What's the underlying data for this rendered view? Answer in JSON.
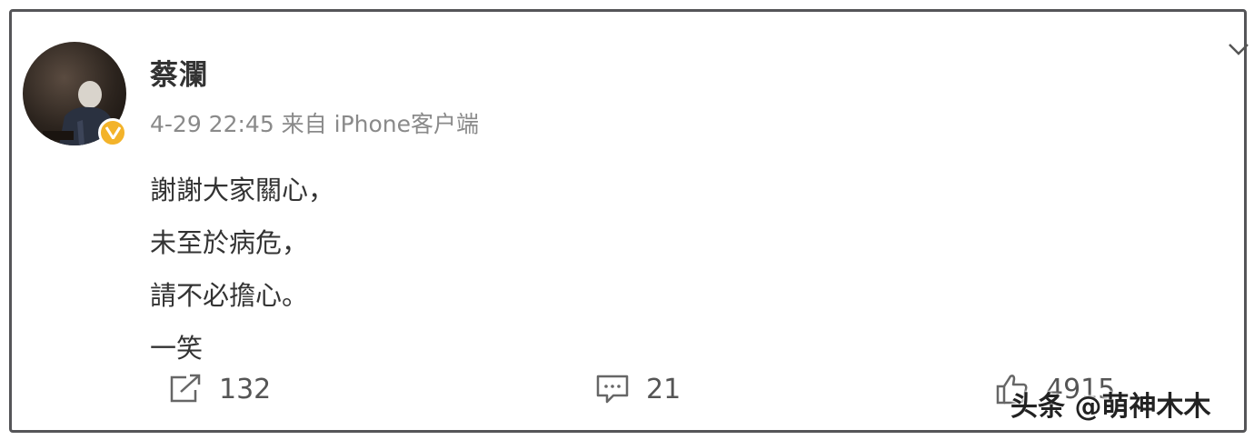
{
  "post": {
    "author": "蔡瀾",
    "meta": "4-29 22:45  来自 iPhone客户端",
    "content_lines": [
      "謝謝大家關心，",
      "未至於病危，",
      "請不必擔心。",
      "一笑"
    ]
  },
  "actions": {
    "repost_count": "132",
    "comment_count": "21",
    "like_count": "4915"
  },
  "watermark": "头条 @萌神木木",
  "icons": {
    "avatar": "avatar-photo",
    "verified": "verified-badge-icon",
    "menu": "chevron-down-icon",
    "repost": "repost-icon",
    "comment": "comment-icon",
    "like": "thumbs-up-icon"
  },
  "colors": {
    "verified_badge": "#f3b32a",
    "text": "#333333",
    "meta": "#8a8a8a"
  }
}
